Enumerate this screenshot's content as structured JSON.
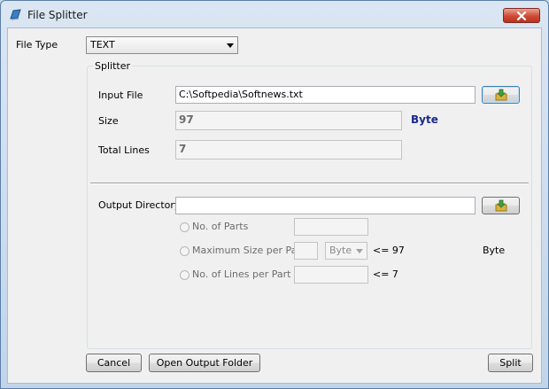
{
  "window": {
    "title": "File Splitter"
  },
  "file_type": {
    "label": "File Type",
    "value": "TEXT"
  },
  "splitter": {
    "group_title": "Splitter",
    "input_file": {
      "label": "Input File",
      "value": "C:\\Softpedia\\Softnews.txt"
    },
    "size": {
      "label": "Size",
      "value": "97",
      "unit": "Byte"
    },
    "total_lines": {
      "label": "Total Lines",
      "value": "7"
    },
    "output_directory": {
      "label": "Output Directory",
      "value": ""
    },
    "options": {
      "no_of_parts": {
        "label": "No. of Parts",
        "value": ""
      },
      "max_size": {
        "label": "Maximum Size per Part",
        "value": "",
        "unit_select": "Byte",
        "limit_text": "<=  97",
        "unit": "Byte"
      },
      "no_of_lines": {
        "label": "No. of Lines per Part",
        "value": "",
        "limit_text": "<=  7"
      }
    }
  },
  "buttons": {
    "cancel": "Cancel",
    "open_output_folder": "Open Output Folder",
    "split": "Split"
  },
  "icons": {
    "app": "app-icon",
    "close": "close-icon",
    "browse": "folder-arrow-icon"
  },
  "colors": {
    "titlebar": "#c2d4ea",
    "client": "#f0f0f0",
    "size_unit": "#1a2a8c",
    "close": "#cf4a33"
  }
}
